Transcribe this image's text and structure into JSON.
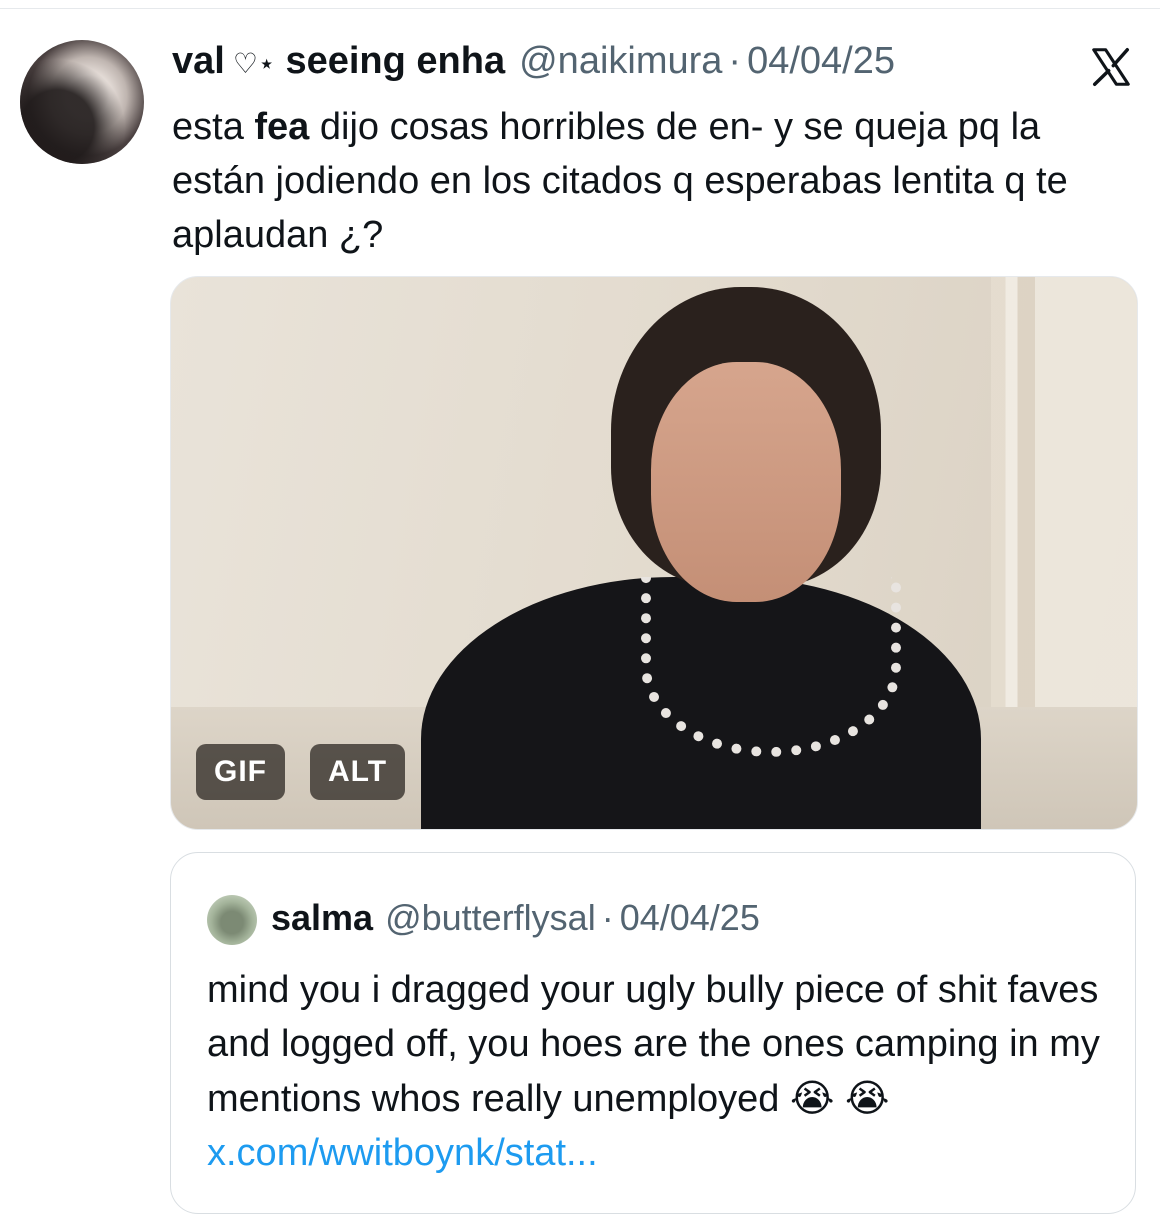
{
  "tweet": {
    "display_name": "val",
    "name_decoration": "♡⋆",
    "name_suffix": "seeing enha",
    "handle": "@naikimura",
    "separator": "·",
    "date": "04/04/25",
    "text_part1": "esta ",
    "text_bold": "fea",
    "text_part2": " dijo cosas horribles de en- y se queja pq la están jodiendo en los citados q esperabas lentita q te aplaudan ¿?"
  },
  "media": {
    "gif_badge": "GIF",
    "alt_badge": "ALT"
  },
  "quote": {
    "display_name": "salma",
    "handle": "@butterflysal",
    "separator": "·",
    "date": "04/04/25",
    "text": "mind you i dragged your ugly bully piece of shit faves and logged off, you hoes are the ones camping in my mentions whos really unemployed ",
    "emoji_1": "😭",
    "emoji_2": "😭",
    "link": "x.com/wwitboynk/stat..."
  },
  "icons": {
    "brand": "x-logo-icon"
  },
  "colors": {
    "text_primary": "#0f1419",
    "text_secondary": "#536471",
    "link": "#1d9bf0",
    "border": "#d9dee2"
  }
}
